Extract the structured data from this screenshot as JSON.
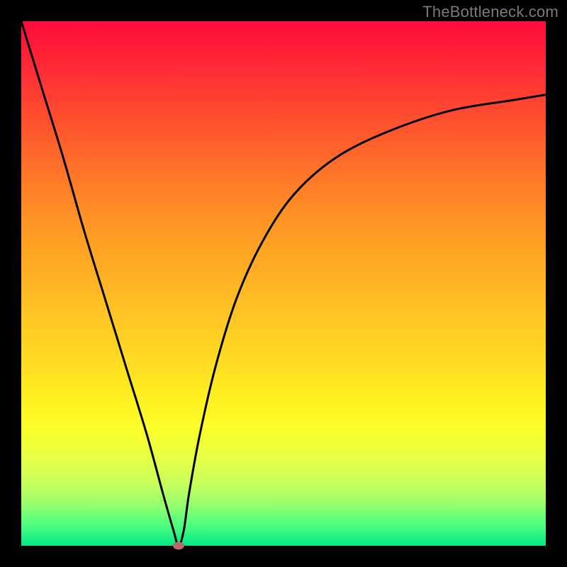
{
  "watermark": "TheBottleneck.com",
  "chart_data": {
    "type": "line",
    "title": "",
    "xlabel": "",
    "ylabel": "",
    "x": [
      0.0,
      0.04,
      0.08,
      0.12,
      0.16,
      0.2,
      0.24,
      0.27,
      0.29,
      0.3,
      0.31,
      0.32,
      0.34,
      0.37,
      0.41,
      0.46,
      0.52,
      0.6,
      0.7,
      0.82,
      0.94,
      1.0
    ],
    "y": [
      1.0,
      0.87,
      0.74,
      0.6,
      0.47,
      0.34,
      0.21,
      0.1,
      0.03,
      0.0,
      0.03,
      0.1,
      0.21,
      0.34,
      0.47,
      0.58,
      0.67,
      0.74,
      0.79,
      0.83,
      0.85,
      0.86
    ],
    "xlim": [
      0,
      1
    ],
    "ylim": [
      0,
      1
    ],
    "marker": {
      "x": 0.3,
      "y": 0.0
    },
    "background": "rainbow-vertical-gradient",
    "colors": {
      "gradient_top": "#ff0a3c",
      "gradient_bottom": "#00e887",
      "line": "#000000",
      "marker": "#b96a6a",
      "frame": "#000000"
    }
  }
}
